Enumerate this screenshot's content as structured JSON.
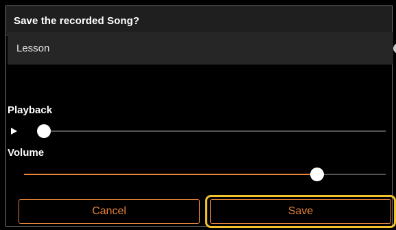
{
  "dialog": {
    "title": "Save the recorded Song?"
  },
  "name_field": {
    "value": "Lesson",
    "clear_icon": "clear-circle-x-icon",
    "clear_glyph": "×"
  },
  "playback": {
    "label": "Playback",
    "play_icon": "play-triangle-icon",
    "position_fraction": 0.0
  },
  "volume": {
    "label": "Volume",
    "level_fraction": 0.81
  },
  "buttons": {
    "cancel_label": "Cancel",
    "save_label": "Save"
  },
  "colors": {
    "accent": "#e8843c",
    "focus_ring": "#f2c12e",
    "track": "#555555",
    "background": "#000000",
    "field_background": "#262626"
  }
}
